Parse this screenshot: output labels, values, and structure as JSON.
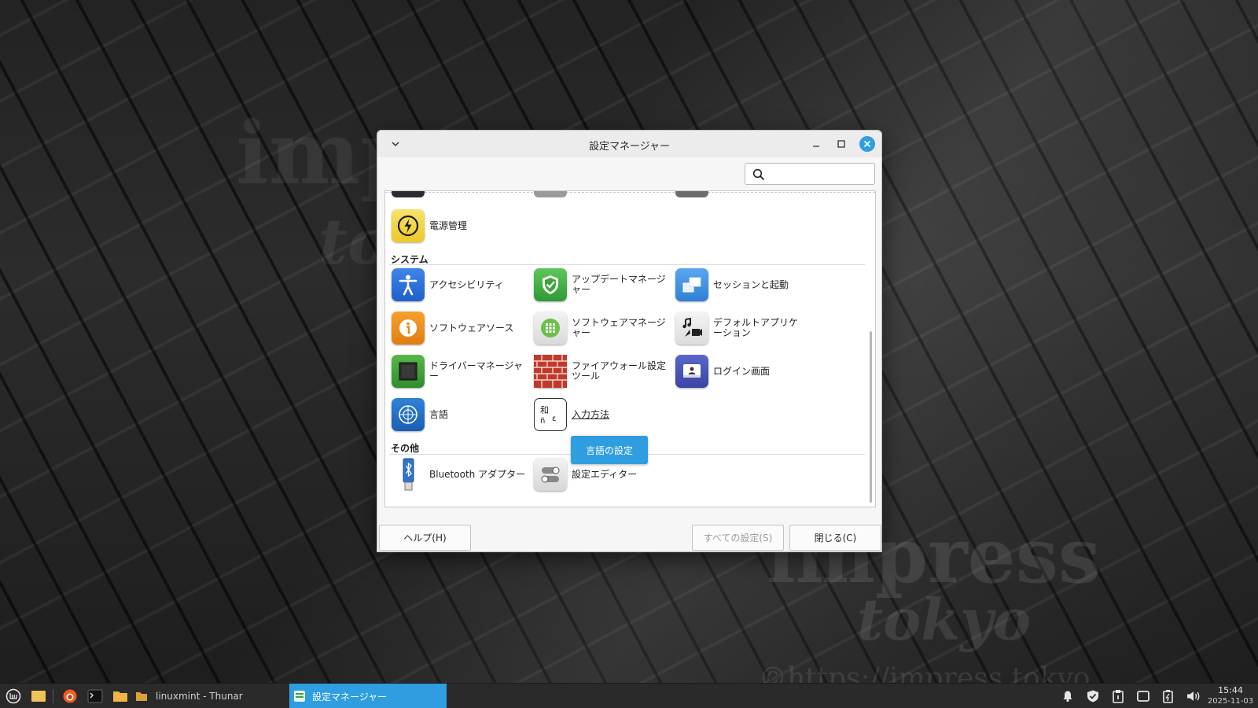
{
  "window": {
    "title": "設定マネージャー",
    "search_placeholder": ""
  },
  "sections": {
    "system": "システム",
    "other": "その他"
  },
  "items": {
    "power": "電源管理",
    "accessibility": "アクセシビリティ",
    "update_manager": "アップデートマネージャー",
    "session_startup": "セッションと起動",
    "software_sources": "ソフトウェアソース",
    "software_manager": "ソフトウェアマネージャー",
    "default_apps": "デフォルトアプリケーション",
    "driver_manager": "ドライバーマネージャー",
    "firewall": "ファイアウォール設定ツール",
    "login_screen": "ログイン画面",
    "language": "言語",
    "input_method": "入力方法",
    "bluetooth": "Bluetooth アダプター",
    "settings_editor": "設定エディター"
  },
  "tooltip": "言語の設定",
  "buttons": {
    "help": "ヘルプ(H)",
    "all_settings": "すべての設定(S)",
    "close": "閉じる(C)"
  },
  "taskbar": {
    "thunar_task": "linuxmint - Thunar",
    "settings_task": "設定マネージャー",
    "time": "15:44",
    "date": "2025-11-03"
  },
  "watermark": {
    "top_word": "imp",
    "top_sub": "to",
    "bottom_word": "impress",
    "bottom_sub": "tokyo",
    "url": "©https://impress.tokyo"
  },
  "colors": {
    "accent": "#2f9ee0",
    "desktop": "#262626",
    "taskbar": "#2a2a2a"
  }
}
